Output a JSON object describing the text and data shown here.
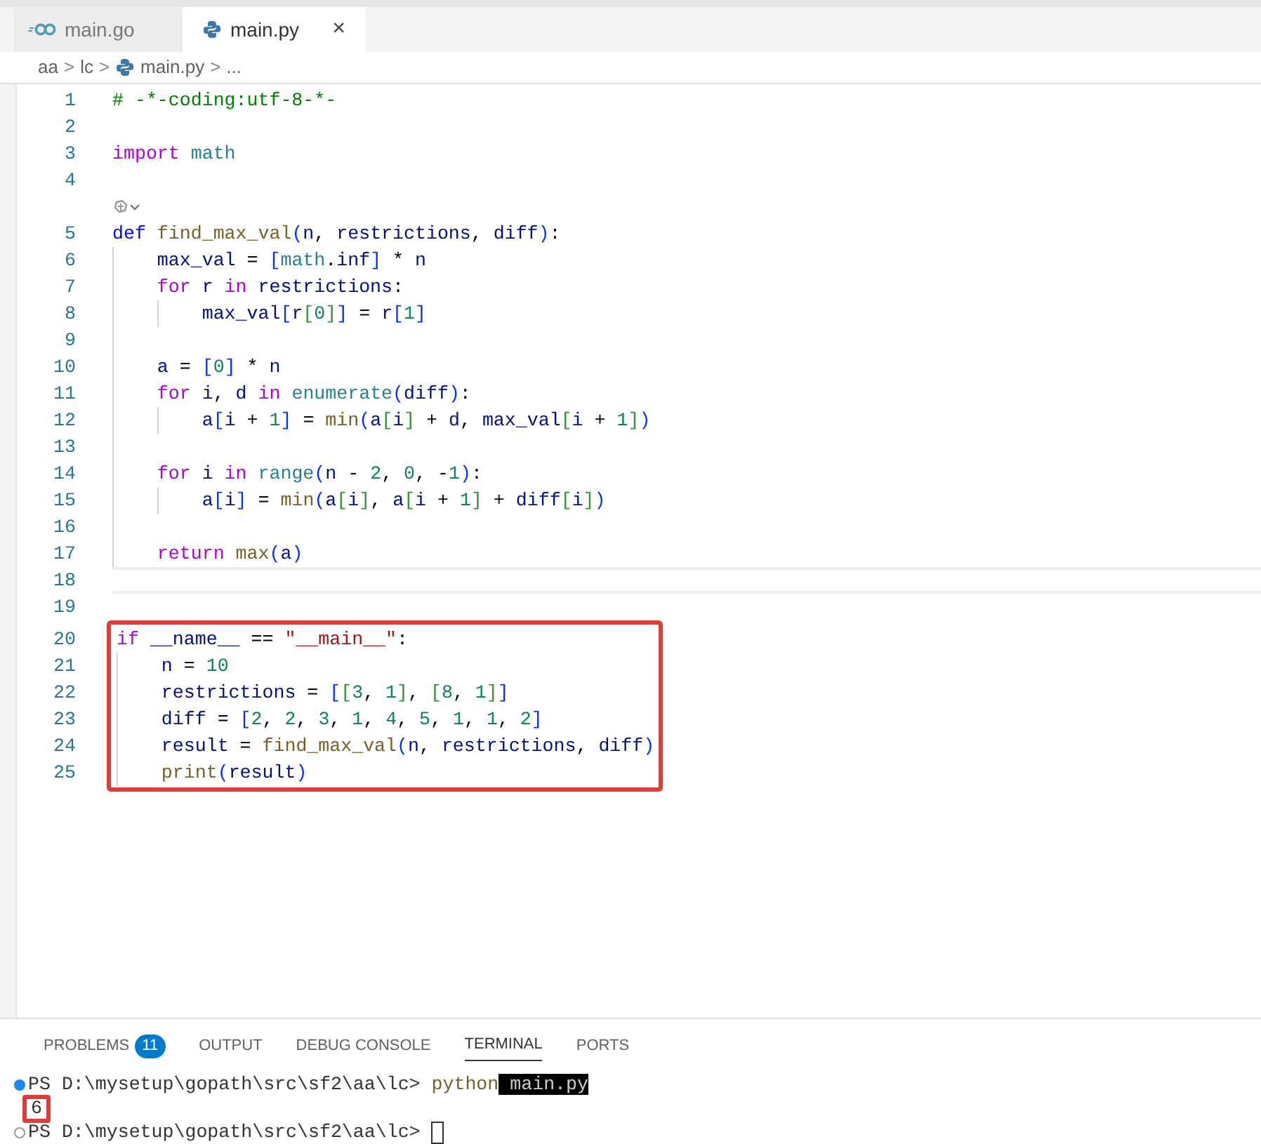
{
  "tabs": [
    {
      "label": "main.go",
      "kind": "go",
      "selected": false
    },
    {
      "label": "main.py",
      "kind": "python",
      "selected": true,
      "close": "×"
    }
  ],
  "breadcrumbs": [
    {
      "label": "aa",
      "kind": "folder"
    },
    {
      "label": "lc",
      "kind": "folder"
    },
    {
      "label": "main.py",
      "kind": "python"
    },
    {
      "label": "...",
      "kind": "symbol"
    }
  ],
  "breadcrumb_separator": ">",
  "editor": {
    "lines": [
      {
        "number": "1",
        "tokens": [
          {
            "text": "# -*-coding:utf-8-*-",
            "kind": "comment"
          }
        ]
      },
      {
        "number": "2"
      },
      {
        "number": "3",
        "tokens": [
          {
            "text": "import",
            "kind": "keyword"
          },
          {
            "text": " math",
            "kind": "module"
          }
        ]
      },
      {
        "number": "4"
      },
      {
        "number": "5",
        "codelens": true,
        "tokens": [
          {
            "text": "def",
            "kind": "storage"
          },
          {
            "text": " find_max_val",
            "kind": "function"
          },
          {
            "text": "(",
            "kind": "bracket1"
          },
          {
            "text": "n",
            "kind": "variable"
          },
          {
            "text": ", ",
            "kind": "plain"
          },
          {
            "text": "restrictions",
            "kind": "variable"
          },
          {
            "text": ", ",
            "kind": "plain"
          },
          {
            "text": "diff",
            "kind": "variable"
          },
          {
            "text": ")",
            "kind": "bracket1"
          },
          {
            "text": ":",
            "kind": "plain"
          }
        ]
      },
      {
        "number": "6",
        "tokens": [
          {
            "text": "    max_val",
            "kind": "variable"
          },
          {
            "text": " = ",
            "kind": "plain"
          },
          {
            "text": "[",
            "kind": "bracket1"
          },
          {
            "text": "math",
            "kind": "module"
          },
          {
            "text": ".",
            "kind": "plain"
          },
          {
            "text": "inf",
            "kind": "variable"
          },
          {
            "text": "]",
            "kind": "bracket1"
          },
          {
            "text": " * ",
            "kind": "plain"
          },
          {
            "text": "n",
            "kind": "variable"
          }
        ]
      },
      {
        "number": "7",
        "tokens": [
          {
            "text": "    for",
            "kind": "keyword"
          },
          {
            "text": " r",
            "kind": "variable"
          },
          {
            "text": " in",
            "kind": "keyword"
          },
          {
            "text": " restrictions",
            "kind": "variable"
          },
          {
            "text": ":",
            "kind": "plain"
          }
        ]
      },
      {
        "number": "8",
        "tokens": [
          {
            "text": "        max_val",
            "kind": "variable"
          },
          {
            "text": "[",
            "kind": "bracket1"
          },
          {
            "text": "r",
            "kind": "variable"
          },
          {
            "text": "[",
            "kind": "bracket2"
          },
          {
            "text": "0",
            "kind": "number"
          },
          {
            "text": "]",
            "kind": "bracket2"
          },
          {
            "text": "]",
            "kind": "bracket1"
          },
          {
            "text": " = ",
            "kind": "plain"
          },
          {
            "text": "r",
            "kind": "variable"
          },
          {
            "text": "[",
            "kind": "bracket1"
          },
          {
            "text": "1",
            "kind": "number"
          },
          {
            "text": "]",
            "kind": "bracket1"
          }
        ]
      },
      {
        "number": "9"
      },
      {
        "number": "10",
        "tokens": [
          {
            "text": "    a",
            "kind": "variable"
          },
          {
            "text": " = ",
            "kind": "plain"
          },
          {
            "text": "[",
            "kind": "bracket1"
          },
          {
            "text": "0",
            "kind": "number"
          },
          {
            "text": "]",
            "kind": "bracket1"
          },
          {
            "text": " * ",
            "kind": "plain"
          },
          {
            "text": "n",
            "kind": "variable"
          }
        ]
      },
      {
        "number": "11",
        "tokens": [
          {
            "text": "    for",
            "kind": "keyword"
          },
          {
            "text": " i",
            "kind": "variable"
          },
          {
            "text": ", ",
            "kind": "plain"
          },
          {
            "text": "d",
            "kind": "variable"
          },
          {
            "text": " in",
            "kind": "keyword"
          },
          {
            "text": " enumerate",
            "kind": "builtin"
          },
          {
            "text": "(",
            "kind": "bracket1"
          },
          {
            "text": "diff",
            "kind": "variable"
          },
          {
            "text": ")",
            "kind": "bracket1"
          },
          {
            "text": ":",
            "kind": "plain"
          }
        ]
      },
      {
        "number": "12",
        "tokens": [
          {
            "text": "        a",
            "kind": "variable"
          },
          {
            "text": "[",
            "kind": "bracket1"
          },
          {
            "text": "i",
            "kind": "variable"
          },
          {
            "text": " + ",
            "kind": "plain"
          },
          {
            "text": "1",
            "kind": "number"
          },
          {
            "text": "]",
            "kind": "bracket1"
          },
          {
            "text": " = ",
            "kind": "plain"
          },
          {
            "text": "min",
            "kind": "function"
          },
          {
            "text": "(",
            "kind": "bracket1"
          },
          {
            "text": "a",
            "kind": "variable"
          },
          {
            "text": "[",
            "kind": "bracket2"
          },
          {
            "text": "i",
            "kind": "variable"
          },
          {
            "text": "]",
            "kind": "bracket2"
          },
          {
            "text": " + ",
            "kind": "plain"
          },
          {
            "text": "d",
            "kind": "variable"
          },
          {
            "text": ", ",
            "kind": "plain"
          },
          {
            "text": "max_val",
            "kind": "variable"
          },
          {
            "text": "[",
            "kind": "bracket2"
          },
          {
            "text": "i",
            "kind": "variable"
          },
          {
            "text": " + ",
            "kind": "plain"
          },
          {
            "text": "1",
            "kind": "number"
          },
          {
            "text": "]",
            "kind": "bracket2"
          },
          {
            "text": ")",
            "kind": "bracket1"
          }
        ]
      },
      {
        "number": "13"
      },
      {
        "number": "14",
        "tokens": [
          {
            "text": "    for",
            "kind": "keyword"
          },
          {
            "text": " i",
            "kind": "variable"
          },
          {
            "text": " in",
            "kind": "keyword"
          },
          {
            "text": " range",
            "kind": "builtin"
          },
          {
            "text": "(",
            "kind": "bracket1"
          },
          {
            "text": "n",
            "kind": "variable"
          },
          {
            "text": " - ",
            "kind": "plain"
          },
          {
            "text": "2",
            "kind": "number"
          },
          {
            "text": ", ",
            "kind": "plain"
          },
          {
            "text": "0",
            "kind": "number"
          },
          {
            "text": ", -",
            "kind": "plain"
          },
          {
            "text": "1",
            "kind": "number"
          },
          {
            "text": ")",
            "kind": "bracket1"
          },
          {
            "text": ":",
            "kind": "plain"
          }
        ]
      },
      {
        "number": "15",
        "tokens": [
          {
            "text": "        a",
            "kind": "variable"
          },
          {
            "text": "[",
            "kind": "bracket1"
          },
          {
            "text": "i",
            "kind": "variable"
          },
          {
            "text": "]",
            "kind": "bracket1"
          },
          {
            "text": " = ",
            "kind": "plain"
          },
          {
            "text": "min",
            "kind": "function"
          },
          {
            "text": "(",
            "kind": "bracket1"
          },
          {
            "text": "a",
            "kind": "variable"
          },
          {
            "text": "[",
            "kind": "bracket2"
          },
          {
            "text": "i",
            "kind": "variable"
          },
          {
            "text": "]",
            "kind": "bracket2"
          },
          {
            "text": ", ",
            "kind": "plain"
          },
          {
            "text": "a",
            "kind": "variable"
          },
          {
            "text": "[",
            "kind": "bracket2"
          },
          {
            "text": "i",
            "kind": "variable"
          },
          {
            "text": " + ",
            "kind": "plain"
          },
          {
            "text": "1",
            "kind": "number"
          },
          {
            "text": "]",
            "kind": "bracket2"
          },
          {
            "text": " + ",
            "kind": "plain"
          },
          {
            "text": "diff",
            "kind": "variable"
          },
          {
            "text": "[",
            "kind": "bracket2"
          },
          {
            "text": "i",
            "kind": "variable"
          },
          {
            "text": "]",
            "kind": "bracket2"
          },
          {
            "text": ")",
            "kind": "bracket1"
          }
        ]
      },
      {
        "number": "16"
      },
      {
        "number": "17",
        "tokens": [
          {
            "text": "    return",
            "kind": "keyword"
          },
          {
            "text": " max",
            "kind": "function"
          },
          {
            "text": "(",
            "kind": "bracket1"
          },
          {
            "text": "a",
            "kind": "variable"
          },
          {
            "text": ")",
            "kind": "bracket1"
          }
        ]
      },
      {
        "number": "18",
        "current": true
      },
      {
        "number": "19"
      },
      {
        "number": "20",
        "boxed": true,
        "tokens": [
          {
            "text": "if",
            "kind": "keyword"
          },
          {
            "text": " __name__",
            "kind": "variable"
          },
          {
            "text": " == ",
            "kind": "plain"
          },
          {
            "text": "\"__main__\"",
            "kind": "string"
          },
          {
            "text": ":",
            "kind": "plain"
          }
        ]
      },
      {
        "number": "21",
        "boxed": true,
        "tokens": [
          {
            "text": "    n",
            "kind": "variable"
          },
          {
            "text": " = ",
            "kind": "plain"
          },
          {
            "text": "10",
            "kind": "number"
          }
        ]
      },
      {
        "number": "22",
        "boxed": true,
        "tokens": [
          {
            "text": "    restrictions",
            "kind": "variable"
          },
          {
            "text": " = ",
            "kind": "plain"
          },
          {
            "text": "[",
            "kind": "bracket1"
          },
          {
            "text": "[",
            "kind": "bracket2"
          },
          {
            "text": "3",
            "kind": "number"
          },
          {
            "text": ", ",
            "kind": "plain"
          },
          {
            "text": "1",
            "kind": "number"
          },
          {
            "text": "]",
            "kind": "bracket2"
          },
          {
            "text": ", ",
            "kind": "plain"
          },
          {
            "text": "[",
            "kind": "bracket2"
          },
          {
            "text": "8",
            "kind": "number"
          },
          {
            "text": ", ",
            "kind": "plain"
          },
          {
            "text": "1",
            "kind": "number"
          },
          {
            "text": "]",
            "kind": "bracket2"
          },
          {
            "text": "]",
            "kind": "bracket1"
          }
        ]
      },
      {
        "number": "23",
        "boxed": true,
        "tokens": [
          {
            "text": "    diff",
            "kind": "variable"
          },
          {
            "text": " = ",
            "kind": "plain"
          },
          {
            "text": "[",
            "kind": "bracket1"
          },
          {
            "text": "2",
            "kind": "number"
          },
          {
            "text": ", ",
            "kind": "plain"
          },
          {
            "text": "2",
            "kind": "number"
          },
          {
            "text": ", ",
            "kind": "plain"
          },
          {
            "text": "3",
            "kind": "number"
          },
          {
            "text": ", ",
            "kind": "plain"
          },
          {
            "text": "1",
            "kind": "number"
          },
          {
            "text": ", ",
            "kind": "plain"
          },
          {
            "text": "4",
            "kind": "number"
          },
          {
            "text": ", ",
            "kind": "plain"
          },
          {
            "text": "5",
            "kind": "number"
          },
          {
            "text": ", ",
            "kind": "plain"
          },
          {
            "text": "1",
            "kind": "number"
          },
          {
            "text": ", ",
            "kind": "plain"
          },
          {
            "text": "1",
            "kind": "number"
          },
          {
            "text": ", ",
            "kind": "plain"
          },
          {
            "text": "2",
            "kind": "number"
          },
          {
            "text": "]",
            "kind": "bracket1"
          }
        ]
      },
      {
        "number": "24",
        "boxed": true,
        "tokens": [
          {
            "text": "    result",
            "kind": "variable"
          },
          {
            "text": " = ",
            "kind": "plain"
          },
          {
            "text": "find_max_val",
            "kind": "function"
          },
          {
            "text": "(",
            "kind": "bracket1"
          },
          {
            "text": "n",
            "kind": "variable"
          },
          {
            "text": ", ",
            "kind": "plain"
          },
          {
            "text": "restrictions",
            "kind": "variable"
          },
          {
            "text": ", ",
            "kind": "plain"
          },
          {
            "text": "diff",
            "kind": "variable"
          },
          {
            "text": ")",
            "kind": "bracket1"
          }
        ]
      },
      {
        "number": "25",
        "boxed": true,
        "tokens": [
          {
            "text": "    print",
            "kind": "function"
          },
          {
            "text": "(",
            "kind": "bracket1"
          },
          {
            "text": "result",
            "kind": "variable"
          },
          {
            "text": ")",
            "kind": "bracket1"
          }
        ]
      }
    ]
  },
  "panel": {
    "tabs": [
      {
        "label": "PROBLEMS",
        "badge": "11",
        "selected": false
      },
      {
        "label": "OUTPUT",
        "selected": false
      },
      {
        "label": "DEBUG CONSOLE",
        "selected": false
      },
      {
        "label": "TERMINAL",
        "selected": true
      },
      {
        "label": "PORTS",
        "selected": false
      }
    ],
    "terminal": [
      {
        "command_succeeded": true,
        "tokens": [
          {
            "text": "PS D:\\mysetup\\gopath\\src\\sf2\\aa\\lc> ",
            "kind": "prompt"
          },
          {
            "text": "python",
            "kind": "command"
          },
          {
            "text": " main.py",
            "kind": "selected"
          }
        ]
      },
      {
        "boxed": true,
        "tokens": [
          {
            "text": "6",
            "kind": "output"
          }
        ]
      },
      {
        "command_succeeded": false,
        "cursor": true,
        "tokens": [
          {
            "text": "PS D:\\mysetup\\gopath\\src\\sf2\\aa\\lc> ",
            "kind": "prompt"
          }
        ]
      }
    ]
  }
}
